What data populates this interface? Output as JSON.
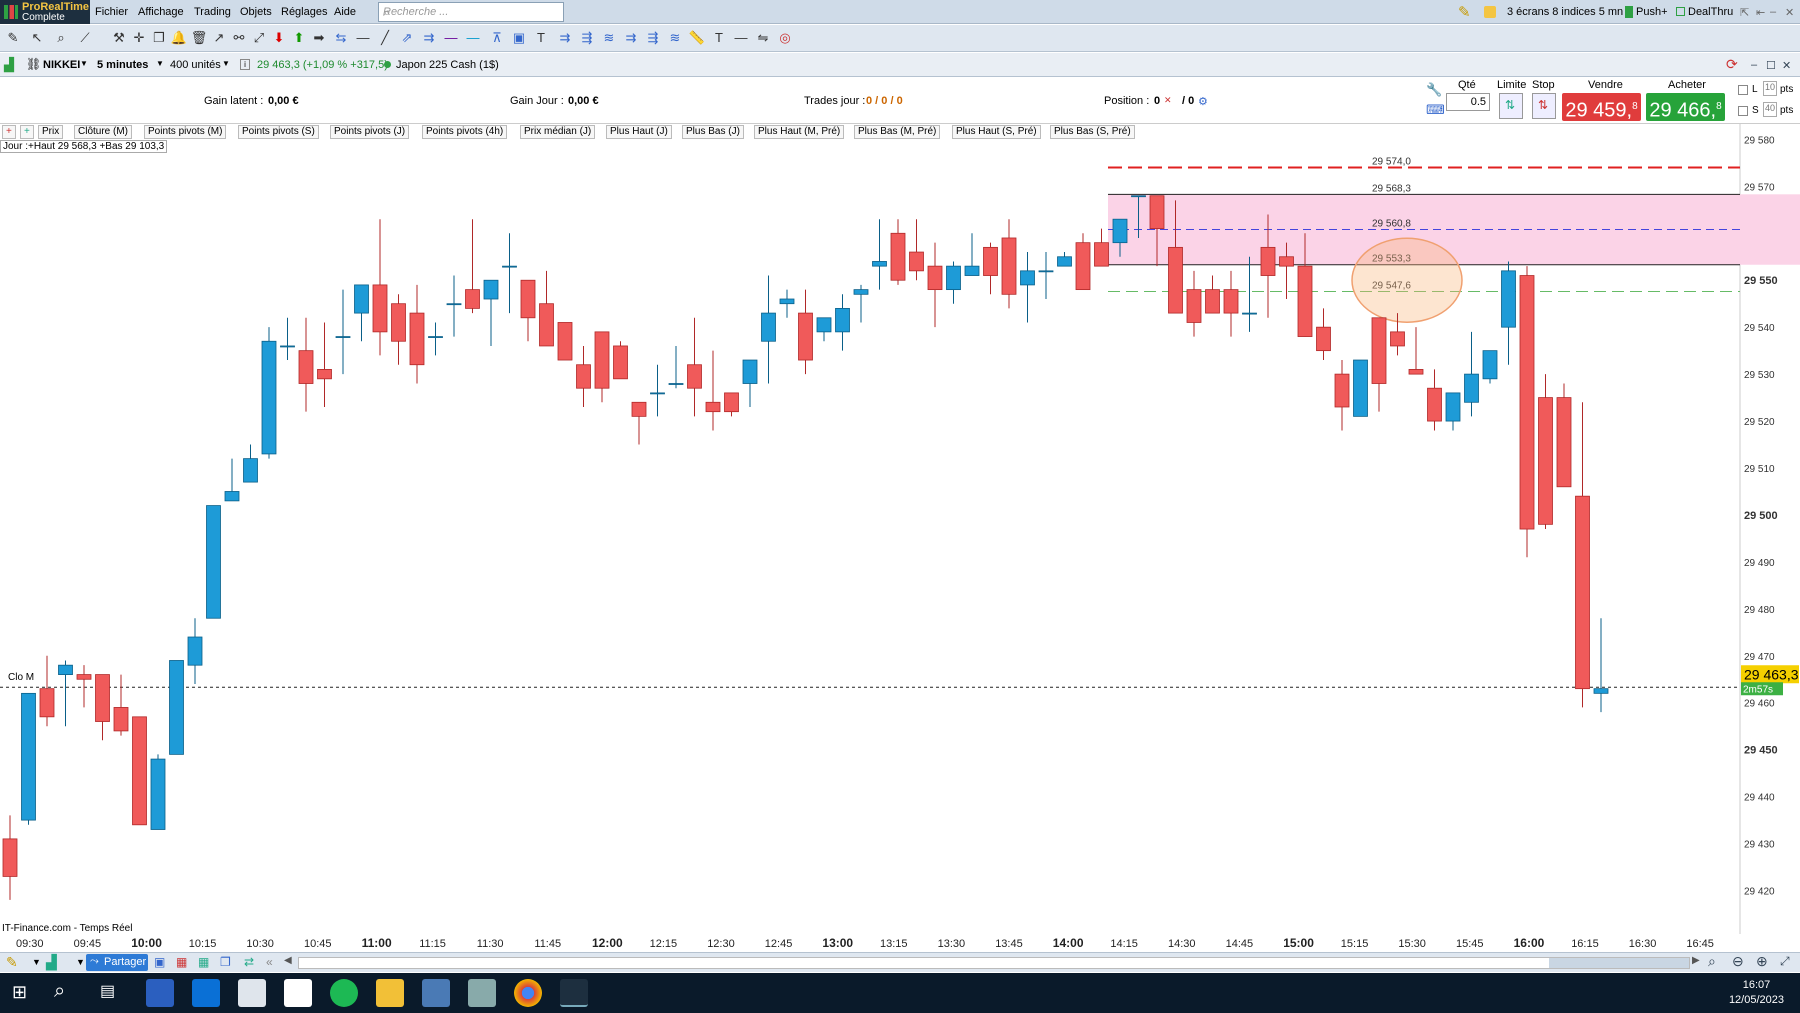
{
  "app": {
    "logo_line1": "ProRealTime",
    "logo_line2": "Complete"
  },
  "menu": [
    "Fichier",
    "Affichage",
    "Trading",
    "Objets",
    "Réglages",
    "Aide"
  ],
  "search": {
    "placeholder": "Recherche ..."
  },
  "topright": {
    "layout": "3 écrans 8 indices 5 mn",
    "push": "Push+",
    "dealthru": "DealThru"
  },
  "instrument": {
    "name": "NIKKEI",
    "period": "5 minutes",
    "units": "400 unités",
    "quote": "29 463,3 (+1,09 % +317,5)",
    "desc": "Japon 225 Cash (1$)"
  },
  "trade": {
    "gain_latent_label": "Gain latent :",
    "gain_latent": "0,00 €",
    "gain_jour_label": "Gain Jour :",
    "gain_jour": "0,00 €",
    "trades_label": "Trades jour :",
    "trades": "0 / 0 / 0",
    "position_label": "Position :",
    "position": "0",
    "position2": "/ 0",
    "qte_label": "Qté",
    "qte": "0.5",
    "limite_label": "Limite",
    "stop_label": "Stop",
    "vendre_label": "Vendre",
    "acheter_label": "Acheter",
    "sell_price": "29 459,",
    "sell_sup": "8",
    "buy_price": "29 466,",
    "buy_sup": "8",
    "l_label": "L",
    "s_label": "S",
    "l_pts": "10",
    "s_pts": "40",
    "pts": "pts"
  },
  "legend": [
    "Prix",
    "Clôture (M)",
    "Points pivots (M)",
    "Points pivots (S)",
    "Points pivots (J)",
    "Points pivots (4h)",
    "Prix médian (J)",
    "Plus Haut (J)",
    "Plus Bas (J)",
    "Plus Haut (M, Pré)",
    "Plus Bas (M, Pré)",
    "Plus Haut (S, Pré)",
    "Plus Bas (S, Pré)"
  ],
  "day_box": "Jour :+Haut 29 568,3 +Bas 29 103,3",
  "source": "IT-Finance.com - Temps Réel",
  "clo_label": "Clo M",
  "status": {
    "share": "Partager"
  },
  "clock": {
    "time": "16:07",
    "date": "12/05/2023"
  },
  "chart_data": {
    "type": "candlestick",
    "ylim": [
      29415,
      29582
    ],
    "y_ticks": [
      "29 580",
      "29 570",
      "29 560",
      "29 550",
      "29 540",
      "29 530",
      "29 520",
      "29 510",
      "29 500",
      "29 490",
      "29 480",
      "29 470",
      "29 460",
      "29 450",
      "29 440",
      "29 430",
      "29 420"
    ],
    "x_ticks": [
      "09:30",
      "09:45",
      "10:00",
      "10:15",
      "10:30",
      "10:45",
      "11:00",
      "11:15",
      "11:30",
      "11:45",
      "12:00",
      "12:15",
      "12:30",
      "12:45",
      "13:00",
      "13:15",
      "13:30",
      "13:45",
      "14:00",
      "14:15",
      "14:30",
      "14:45",
      "15:00",
      "15:15",
      "15:30",
      "15:45",
      "16:00",
      "16:15",
      "16:30",
      "16:45"
    ],
    "levels": [
      {
        "label": "29 574,0",
        "value": 29574.0,
        "style": "red-dash"
      },
      {
        "label": "29 568,3",
        "value": 29568.3,
        "style": "black"
      },
      {
        "label": "29 560,8",
        "value": 29560.8,
        "style": "blue-dash"
      },
      {
        "label": "29 553,3",
        "value": 29553.3,
        "style": "black"
      },
      {
        "label": "29 547,6",
        "value": 29547.6,
        "style": "green-dash"
      }
    ],
    "zone": [
      29553.3,
      29568.3
    ],
    "last_price": "29 463,3",
    "last_value": 29463.3,
    "countdown": "2m57s",
    "candles": [
      [
        29431,
        29436,
        29418,
        29423
      ],
      [
        29435,
        29462,
        29434,
        29462
      ],
      [
        29463,
        29470,
        29455,
        29457
      ],
      [
        29466,
        29469,
        29455,
        29468
      ],
      [
        29466,
        29468,
        29459,
        29465
      ],
      [
        29466,
        29466,
        29452,
        29456
      ],
      [
        29459,
        29466,
        29453,
        29454
      ],
      [
        29457,
        29457,
        29434,
        29434
      ],
      [
        29433,
        29449,
        29434,
        29448
      ],
      [
        29449,
        29469,
        29451,
        29469
      ],
      [
        29468,
        29478,
        29464,
        29474
      ],
      [
        29478,
        29501,
        29480,
        29502
      ],
      [
        29503,
        29512,
        29503,
        29505
      ],
      [
        29507,
        29515,
        29509,
        29512
      ],
      [
        29513,
        29540,
        29512,
        29537
      ],
      [
        29536,
        29542,
        29533,
        29536
      ],
      [
        29535,
        29542,
        29522,
        29528
      ],
      [
        29531,
        29541,
        29523,
        29529
      ],
      [
        29538,
        29548,
        29530,
        29538
      ],
      [
        29543,
        29549,
        29537,
        29549
      ],
      [
        29549,
        29563,
        29534,
        29539
      ],
      [
        29545,
        29547,
        29532,
        29537
      ],
      [
        29543,
        29549,
        29528,
        29532
      ],
      [
        29538,
        29541,
        29534,
        29538
      ],
      [
        29545,
        29551,
        29538,
        29545
      ],
      [
        29548,
        29563,
        29543,
        29544
      ],
      [
        29546,
        29548,
        29536,
        29550
      ],
      [
        29553,
        29560,
        29543,
        29553
      ],
      [
        29550,
        29547,
        29537,
        29542
      ],
      [
        29545,
        29552,
        29536,
        29536
      ],
      [
        29541,
        29540,
        29533,
        29533
      ],
      [
        29532,
        29536,
        29523,
        29527
      ],
      [
        29539,
        29535,
        29524,
        29527
      ],
      [
        29536,
        29537,
        29529,
        29529
      ],
      [
        29524,
        29524,
        29515,
        29521
      ],
      [
        29526,
        29532,
        29521,
        29526
      ],
      [
        29528,
        29536,
        29527,
        29528
      ],
      [
        29532,
        29542,
        29521,
        29527
      ],
      [
        29524,
        29535,
        29518,
        29522
      ],
      [
        29526,
        29526,
        29521,
        29522
      ],
      [
        29528,
        29533,
        29523,
        29533
      ],
      [
        29537,
        29551,
        29528,
        29543
      ],
      [
        29545,
        29548,
        29542,
        29546
      ],
      [
        29543,
        29548,
        29530,
        29533
      ],
      [
        29539,
        29540,
        29537,
        29542
      ],
      [
        29539,
        29547,
        29535,
        29544
      ],
      [
        29547,
        29549,
        29541,
        29548
      ],
      [
        29553,
        29563,
        29548,
        29554
      ],
      [
        29560,
        29563,
        29549,
        29550
      ],
      [
        29556,
        29563,
        29550,
        29552
      ],
      [
        29553,
        29558,
        29540,
        29548
      ],
      [
        29548,
        29554,
        29545,
        29553
      ],
      [
        29551,
        29560,
        29551,
        29553
      ],
      [
        29557,
        29558,
        29547,
        29551
      ],
      [
        29559,
        29563,
        29544,
        29547
      ],
      [
        29549,
        29556,
        29541,
        29552
      ],
      [
        29552,
        29556,
        29546,
        29552
      ],
      [
        29553,
        29556,
        29553,
        29555
      ],
      [
        29558,
        29560,
        29548,
        29548
      ],
      [
        29558,
        29561,
        29556,
        29553
      ],
      [
        29558,
        29563,
        29555,
        29563
      ],
      [
        29568,
        29566,
        29559,
        29568
      ],
      [
        29568,
        29568,
        29553,
        29561
      ],
      [
        29557,
        29567,
        29543,
        29543
      ],
      [
        29548,
        29552,
        29538,
        29541
      ],
      [
        29548,
        29551,
        29543,
        29543
      ],
      [
        29548,
        29552,
        29538,
        29543
      ],
      [
        29543,
        29555,
        29539,
        29543
      ],
      [
        29557,
        29564,
        29542,
        29551
      ],
      [
        29555,
        29558,
        29546,
        29553
      ],
      [
        29553,
        29560,
        29538,
        29538
      ],
      [
        29540,
        29544,
        29533,
        29535
      ],
      [
        29530,
        29533,
        29518,
        29523
      ],
      [
        29521,
        29531,
        29522,
        29533
      ],
      [
        29542,
        29540,
        29522,
        29528
      ],
      [
        29539,
        29543,
        29534,
        29536
      ],
      [
        29531,
        29540,
        29530,
        29530
      ],
      [
        29527,
        29531,
        29518,
        29520
      ],
      [
        29520,
        29526,
        29518,
        29526
      ],
      [
        29524,
        29539,
        29521,
        29530
      ],
      [
        29529,
        29535,
        29528,
        29535
      ],
      [
        29540,
        29554,
        29532,
        29552
      ],
      [
        29551,
        29553,
        29491,
        29497
      ],
      [
        29525,
        29530,
        29497,
        29498
      ],
      [
        29525,
        29528,
        29506,
        29506
      ],
      [
        29504,
        29524,
        29459,
        29463
      ],
      [
        29462,
        29478,
        29458,
        29463
      ]
    ]
  }
}
